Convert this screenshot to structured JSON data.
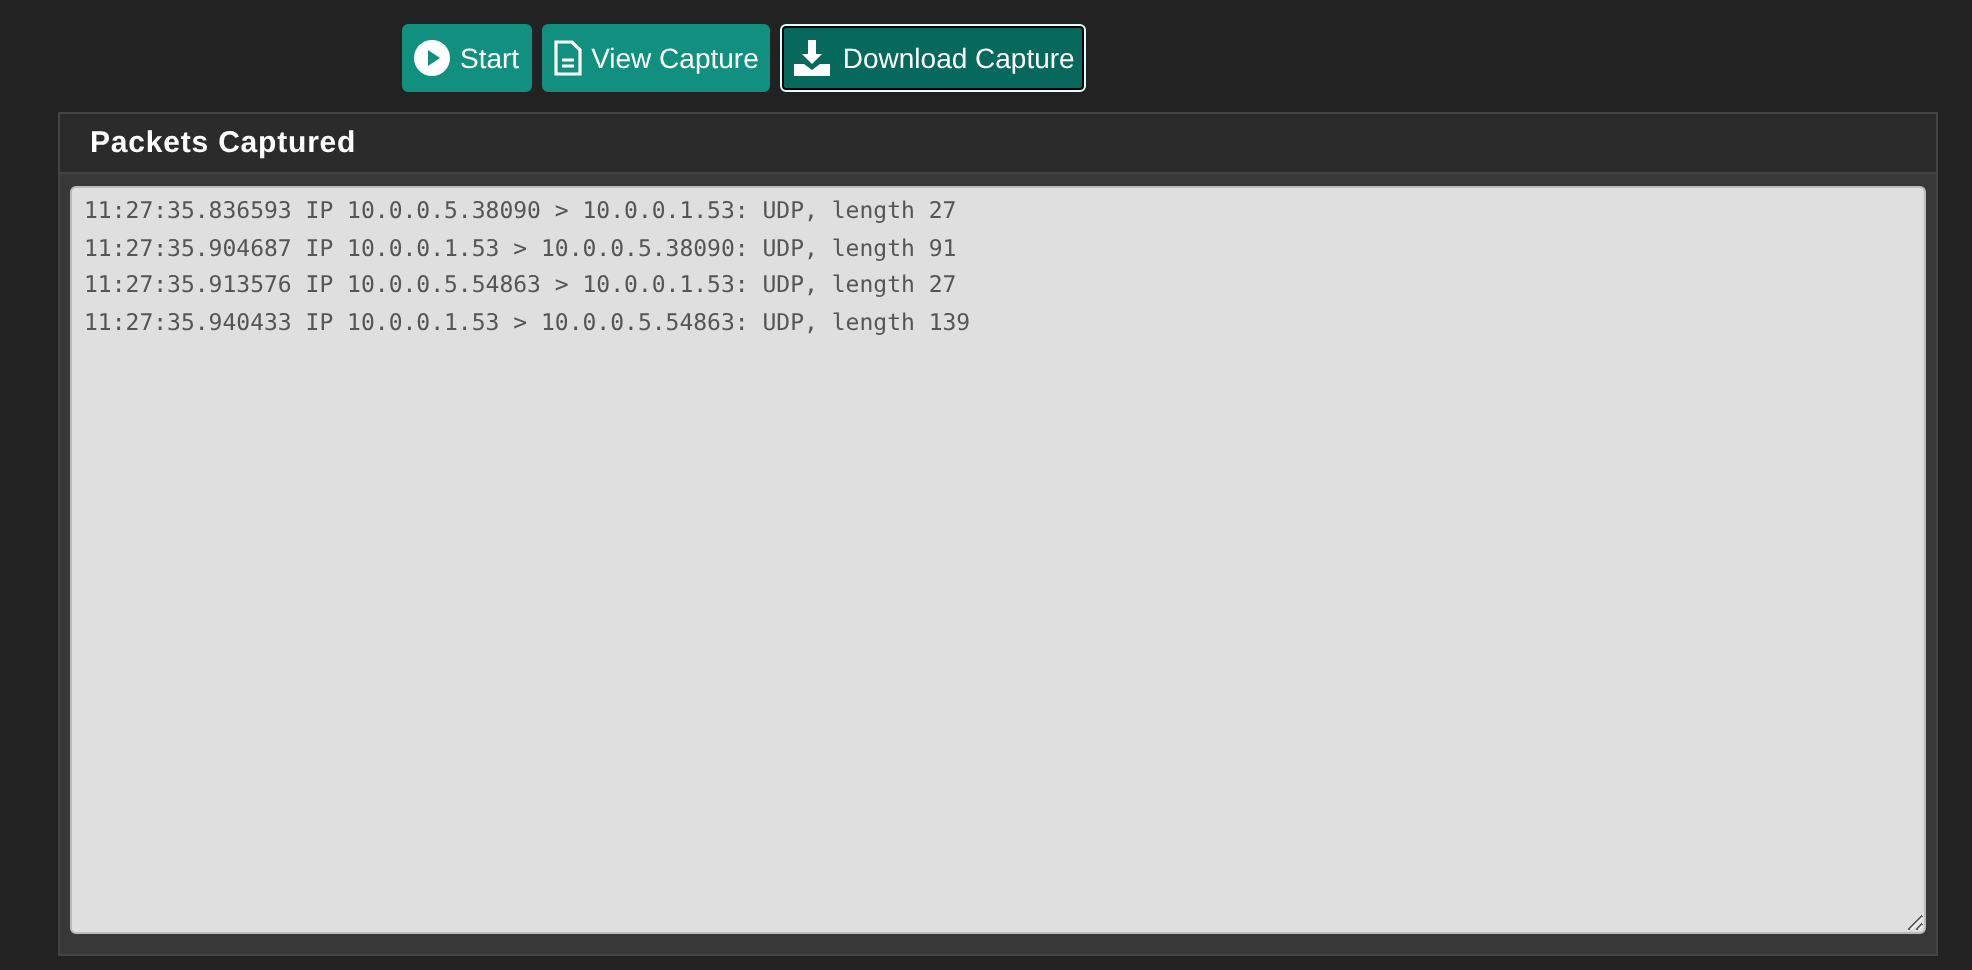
{
  "buttons": [
    {
      "label": "Start",
      "kind": "play",
      "focused": false
    },
    {
      "label": "View Capture",
      "kind": "document",
      "focused": false
    },
    {
      "label": "Download Capture",
      "kind": "download",
      "focused": true
    }
  ],
  "panel": {
    "title": "Packets Captured",
    "lines": [
      "11:27:35.836593 IP 10.0.0.5.38090 > 10.0.0.1.53: UDP, length 27",
      "11:27:35.904687 IP 10.0.0.1.53 > 10.0.0.5.38090: UDP, length 91",
      "11:27:35.913576 IP 10.0.0.5.54863 > 10.0.0.1.53: UDP, length 27",
      "11:27:35.940433 IP 10.0.0.1.53 > 10.0.0.5.54863: UDP, length 139"
    ]
  }
}
